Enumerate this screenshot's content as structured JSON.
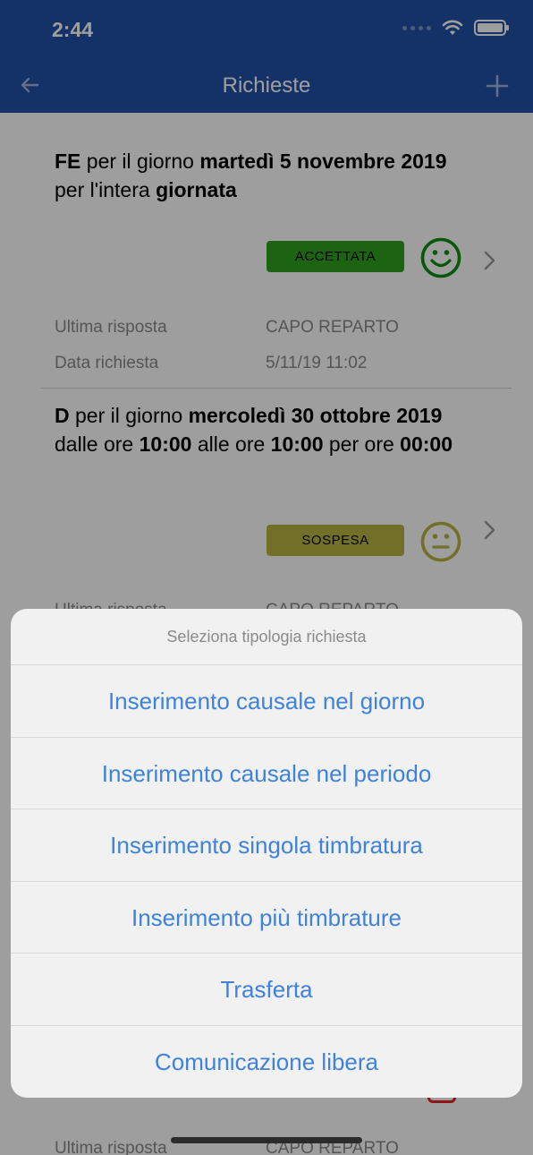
{
  "status_bar": {
    "time": "2:44"
  },
  "header": {
    "title": "Richieste",
    "back_icon": "arrow-left-icon",
    "add_icon": "plus-icon"
  },
  "requests": [
    {
      "segments": [
        {
          "t": "FE",
          "b": true
        },
        {
          "t": " per il giorno ",
          "b": false
        },
        {
          "t": "martedì 5 novembre 2019",
          "b": true
        },
        {
          "t": " per l'intera ",
          "b": false
        },
        {
          "t": "giornata",
          "b": true
        }
      ],
      "status": "ACCETTATA",
      "status_color": "#2ea21d",
      "face": "happy",
      "face_color": "#0f8d0f",
      "meta": [
        {
          "label": "Ultima risposta",
          "value": "CAPO REPARTO"
        },
        {
          "label": "Data richiesta",
          "value": "5/11/19 11:02"
        }
      ]
    },
    {
      "segments": [
        {
          "t": "D",
          "b": true
        },
        {
          "t": " per il giorno ",
          "b": false
        },
        {
          "t": "mercoledì 30 ottobre 2019",
          "b": true
        },
        {
          "t": " dalle ore ",
          "b": false
        },
        {
          "t": "10:00",
          "b": true
        },
        {
          "t": " alle ore ",
          "b": false
        },
        {
          "t": "10:00",
          "b": true
        },
        {
          "t": " per ore ",
          "b": false
        },
        {
          "t": "00:00",
          "b": true
        }
      ],
      "status": "SOSPESA",
      "status_color": "#b9b541",
      "face": "neutral",
      "face_color": "#b9b541",
      "meta": [
        {
          "label": "Ultima risposta",
          "value": "CAPO REPARTO"
        }
      ]
    }
  ],
  "bottom_peek": {
    "label": "Ultima risposta",
    "value": "CAPO REPARTO"
  },
  "action_sheet": {
    "title": "Seleziona tipologia richiesta",
    "options": [
      "Inserimento causale nel giorno",
      "Inserimento causale nel periodo",
      "Inserimento singola timbratura",
      "Inserimento più timbrature",
      "Trasferta",
      "Comunicazione libera"
    ]
  }
}
